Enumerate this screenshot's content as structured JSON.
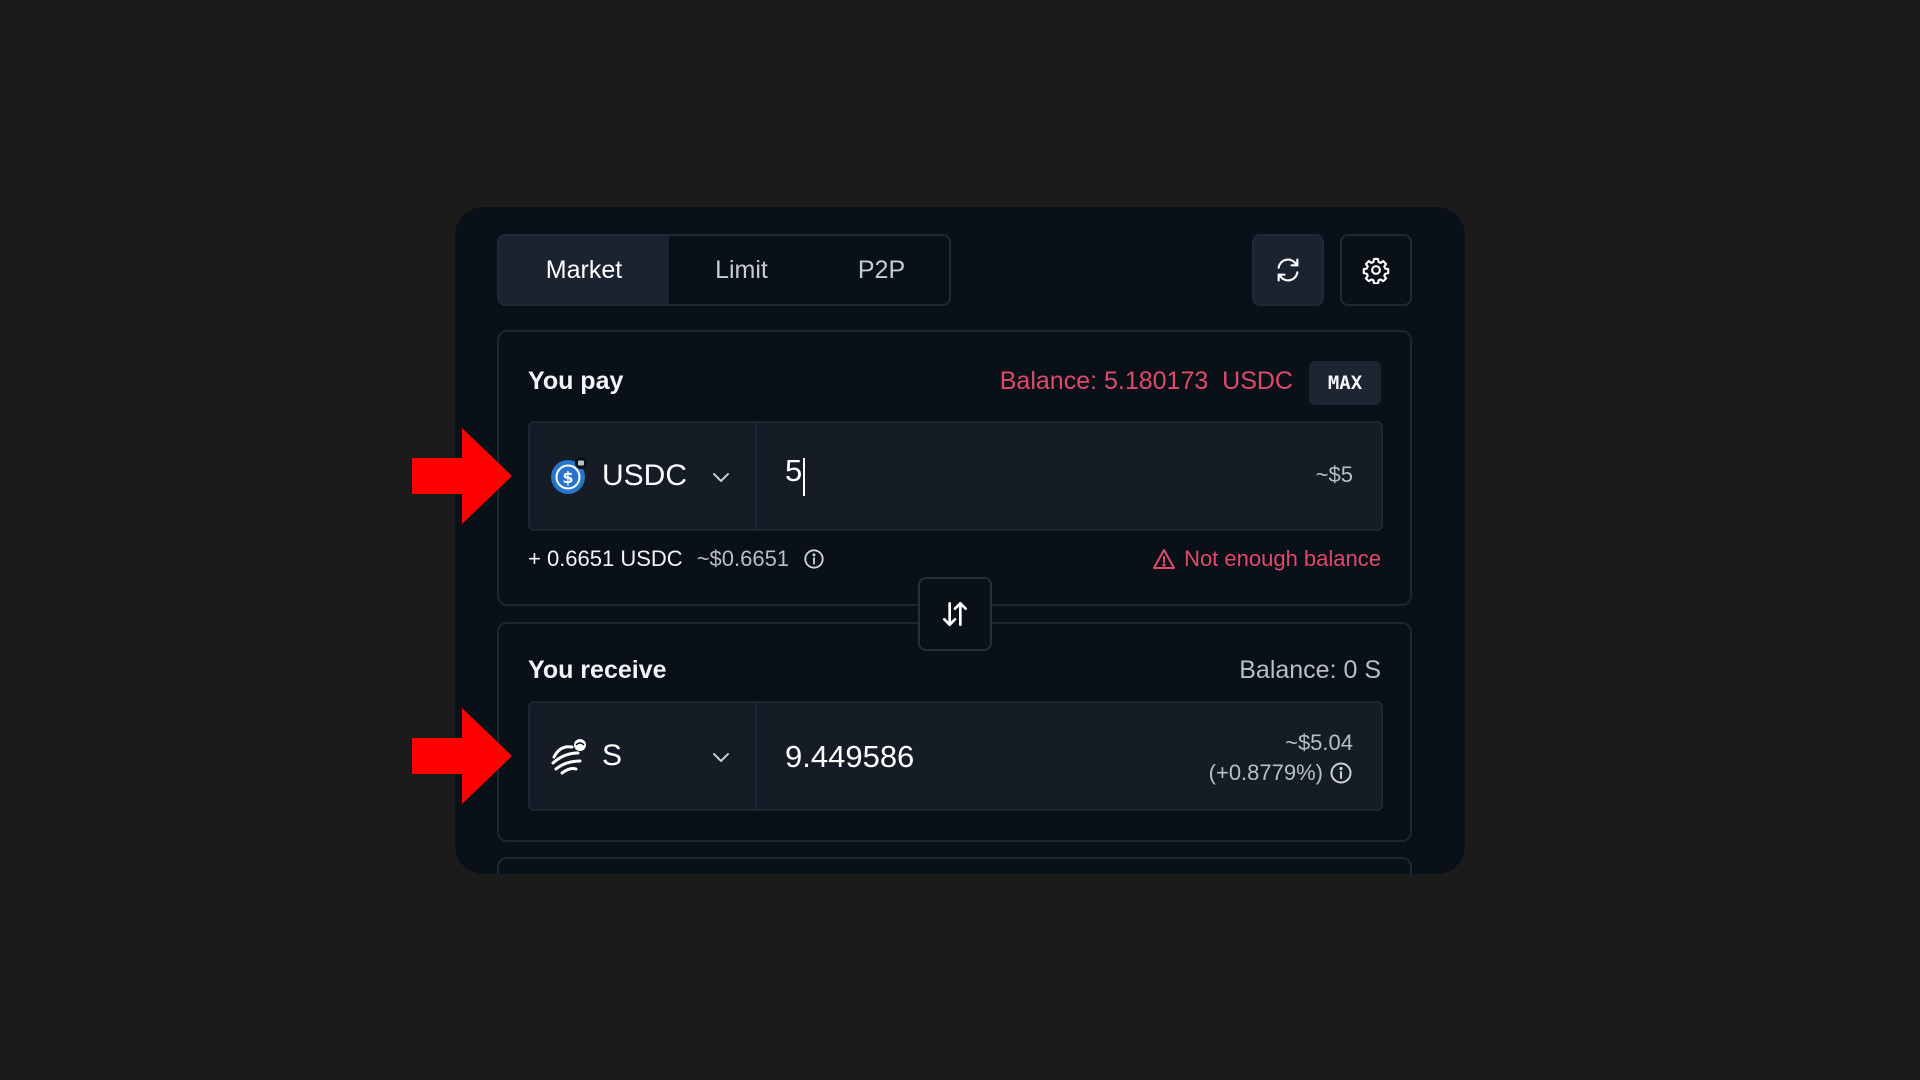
{
  "tabs": [
    {
      "label": "Market",
      "active": true
    },
    {
      "label": "Limit",
      "active": false
    },
    {
      "label": "P2P",
      "active": false
    }
  ],
  "toolbar": {
    "refresh_icon": "refresh-icon",
    "settings_icon": "gear-icon"
  },
  "pay": {
    "label": "You pay",
    "balance_text": "Balance: 5.180173  USDC",
    "max_label": "MAX",
    "token": {
      "symbol": "USDC",
      "icon": "usdc-icon"
    },
    "amount": "5",
    "usd_value": "~$5",
    "fee_amount": "+ 0.6651 USDC",
    "fee_usd": "~$0.6651",
    "warning": "Not enough balance"
  },
  "receive": {
    "label": "You receive",
    "balance_text": "Balance: 0 S",
    "token": {
      "symbol": "S",
      "icon": "sonic-icon"
    },
    "amount": "9.449586",
    "usd_value": "~$5.04",
    "price_impact": "(+0.8779%)"
  },
  "colors": {
    "warning": "#e04a6a",
    "annotation_arrow": "#ff0000",
    "panel_bg": "#0a1017"
  }
}
